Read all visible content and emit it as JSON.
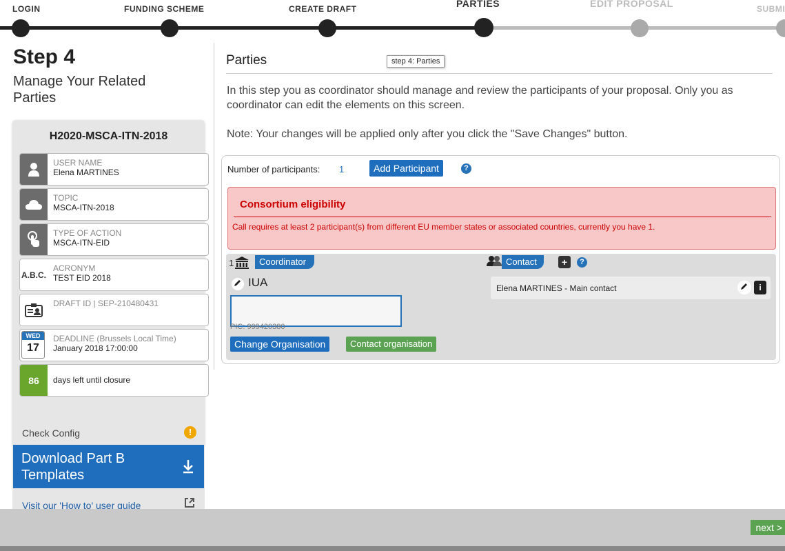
{
  "progress": {
    "steps": [
      {
        "label": "LOGIN",
        "state": "done"
      },
      {
        "label": "FUNDING SCHEME",
        "state": "done"
      },
      {
        "label": "CREATE DRAFT",
        "state": "done"
      },
      {
        "label": "PARTIES",
        "state": "current"
      },
      {
        "label": "EDIT PROPOSAL",
        "state": "future"
      },
      {
        "label": "SUBMI",
        "state": "future"
      }
    ]
  },
  "sidebar": {
    "step_title": "Step 4",
    "step_subtitle": "Manage Your Related Parties",
    "call_id": "H2020-MSCA-ITN-2018",
    "user_label": "USER NAME",
    "user_value": "Elena MARTINES",
    "topic_label": "TOPIC",
    "topic_value": "MSCA-ITN-2018",
    "action_label": "TYPE OF ACTION",
    "action_value": "MSCA-ITN-EID",
    "acronym_icon_text": "A.B.C.",
    "acronym_label": "ACRONYM",
    "acronym_value": "TEST EID 2018",
    "draft_label": "DRAFT ID | SEP-210480431",
    "cal_month": "WED",
    "cal_day": "17",
    "deadline_label": "DEADLINE (Brussels Local Time)",
    "deadline_value": "January 2018 17:00:00",
    "days_left_count": "86",
    "days_left_text": "days left until closure",
    "check_config": "Check Config",
    "download_label": "Download Part B Templates",
    "guide_link": "Visit our 'How to' user guide"
  },
  "main": {
    "title": "Parties",
    "tooltip": "step 4: Parties",
    "intro": "In this step you as coordinator should manage and review the participants of your proposal. Only you as coordinator can edit the elements on this screen.",
    "note": "Note: Your changes will be applied only after you click the \"Save Changes\" button.",
    "participants_label": "Number of participants:",
    "participants_count": "1",
    "add_participant": "Add Participant",
    "error_title": "Consortium eligibility",
    "error_message": "Call requires at least 2 participant(s) from different EU member states or associated countries, currently you have 1.",
    "party": {
      "number": "1",
      "role": "Coordinator",
      "org_name": "IUA",
      "pic_partial": "PIC: 999420380",
      "change_org": "Change Organisation",
      "contact_org": "Contact organisation",
      "contact_tab": "Contact",
      "contact_name": "Elena MARTINES - Main contact"
    }
  },
  "footer": {
    "next_label": "next >"
  },
  "colors": {
    "primary_blue": "#1f6ebd",
    "green": "#5ca253",
    "error_red": "#cc0000",
    "error_bg": "#f8c8c8"
  }
}
